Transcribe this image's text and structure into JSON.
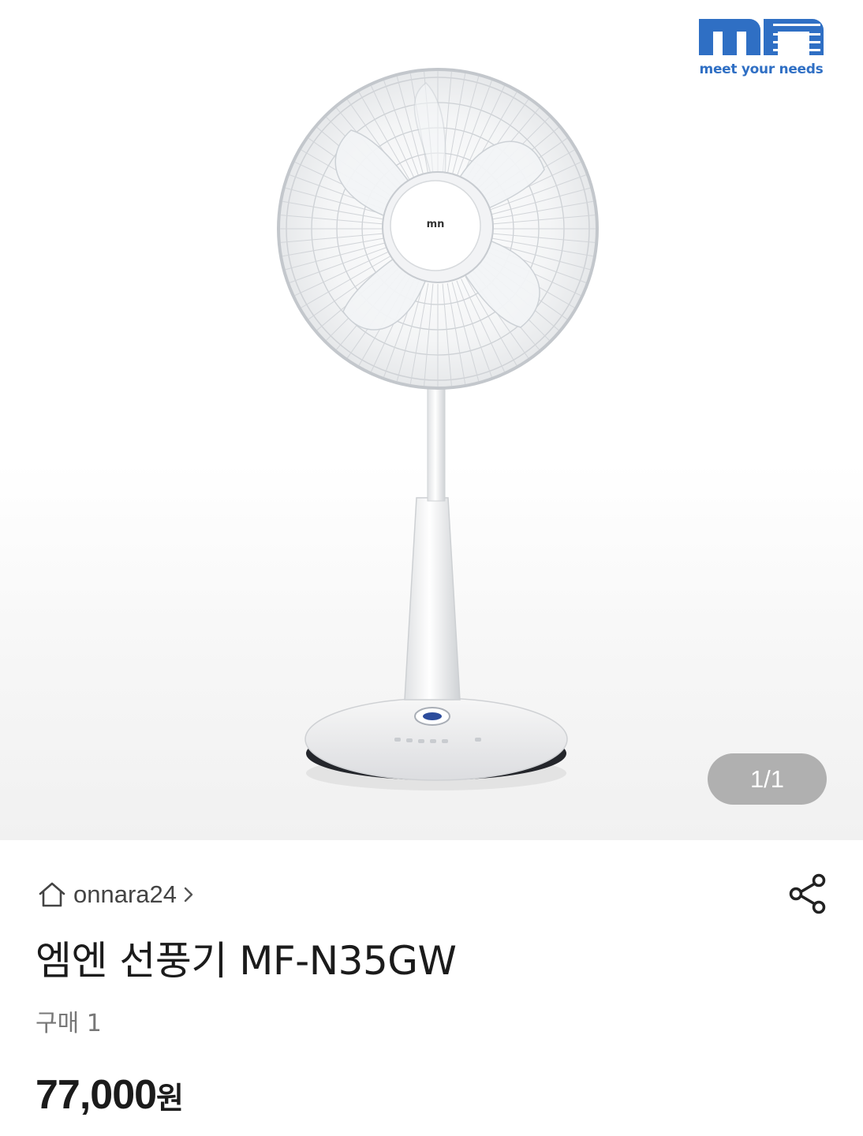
{
  "gallery": {
    "brand_tagline": "meet your needs",
    "product_logo": "mn",
    "counter": "1/1"
  },
  "store": {
    "icon": "home-icon",
    "name": "onnara24",
    "chevron": "›"
  },
  "product": {
    "title": "엠엔 선풍기 MF-N35GW",
    "purchase_count": "구매 1",
    "price_amount": "77,000",
    "price_unit": "원"
  },
  "colors": {
    "brand_blue": "#2f6fc4",
    "text_primary": "#1b1b1b",
    "text_secondary": "#777777"
  }
}
